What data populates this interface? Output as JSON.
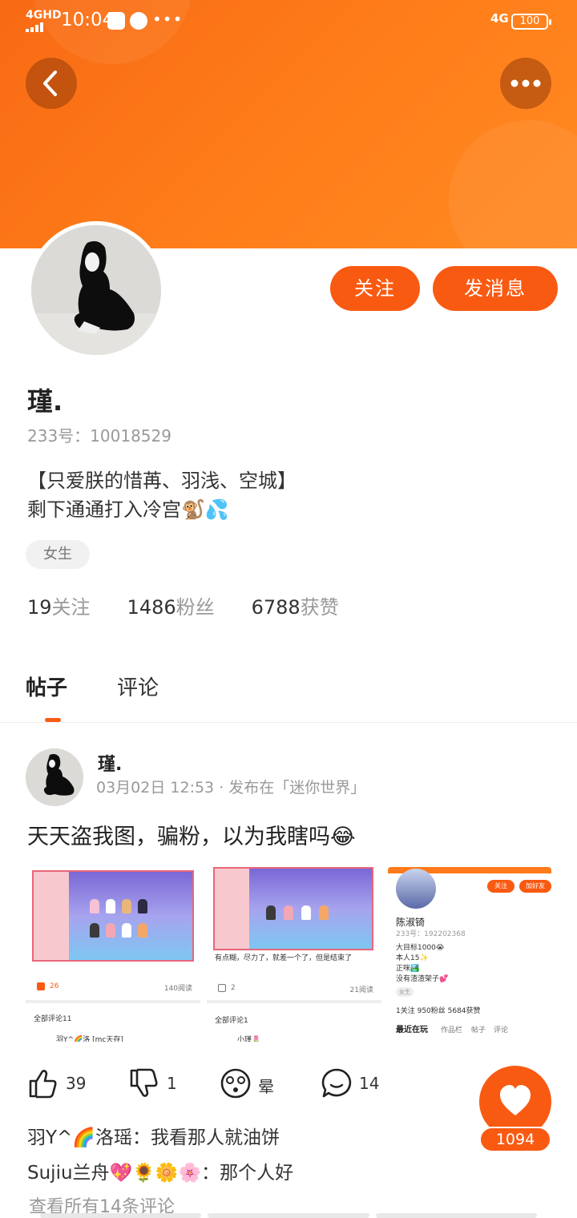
{
  "status_bar": {
    "network": "4GHD",
    "time": "10:04",
    "more": "•••",
    "signal_right": "4G",
    "battery": "100"
  },
  "header": {
    "back_icon": "chevron-left-icon",
    "more_icon": "more-horizontal-icon",
    "banner_color": "#ff7a1a"
  },
  "profile": {
    "username": "瑾.",
    "id_text": "233号：10018529",
    "bio_line1": "【只爱朕的惜苒、羽浅、空城】",
    "bio_line2": "剩下通通打入冷宫🐒💦",
    "gender": "女生",
    "follow_label": "关注",
    "message_label": "发消息",
    "stats": {
      "following_count": "19",
      "following_label": "关注",
      "fans_count": "1486",
      "fans_label": "粉丝",
      "likes_count": "6788",
      "likes_label": "获赞"
    }
  },
  "tabs": [
    {
      "label": "帖子",
      "active": true
    },
    {
      "label": "评论",
      "active": false
    }
  ],
  "post": {
    "author": "瑾.",
    "meta": "03月02日 12:53 · 发布在「迷你世界」",
    "text": "天天盗我图，骗粉，以为我瞎吗😂",
    "images": [
      {
        "likes": "26",
        "reads": "140阅读",
        "comments_header": "全部评论11",
        "commenter": "羽Y^🌈洛 [mc天存]"
      },
      {
        "caption": "有点糊，尽力了，就差一个了，但是结束了",
        "likes": "2",
        "reads": "21阅读",
        "comments_header": "全部评论1",
        "commenter": "小瑾🌷"
      },
      {
        "name": "陈淑锜",
        "id": "233号：192202368",
        "follow": "关注",
        "add_friend": "加好友",
        "bio1": "大目标1000😭",
        "bio2": "本人15✨",
        "bio3": "正咪🏞️",
        "bio4": "没有渣渣架子💕",
        "tag": "女生",
        "stats": "1关注   950粉丝   5684获赞",
        "tab1": "最近在玩",
        "tab2": "作品栏",
        "tab3": "帖子",
        "tab4": "评论"
      }
    ],
    "actions": {
      "like_count": "39",
      "dislike_count": "1",
      "dizzy_label": "晕",
      "comment_count": "14"
    },
    "fab_like_count": "1094",
    "comments": [
      "羽Y^🌈洛瑶：我看那人就油饼",
      "Sujiu兰舟💖🌻🌼🌸：那个人好"
    ],
    "view_all": "查看所有14条评论"
  }
}
